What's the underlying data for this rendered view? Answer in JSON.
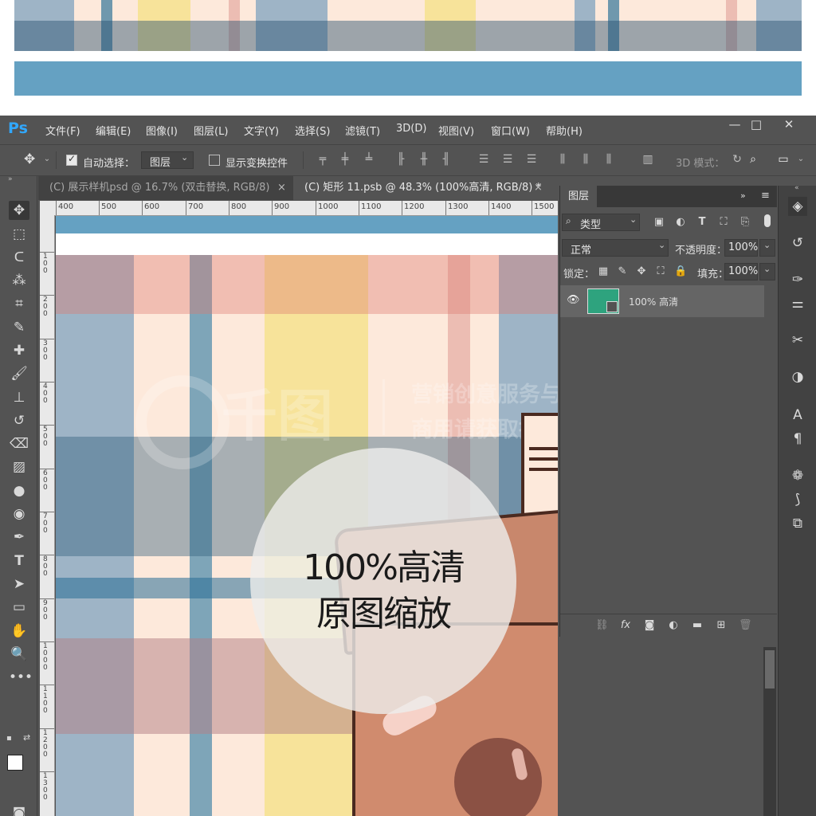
{
  "app": {
    "logo": "Ps",
    "menus": [
      "文件(F)",
      "编辑(E)",
      "图像(I)",
      "图层(L)",
      "文字(Y)",
      "选择(S)",
      "滤镜(T)",
      "3D(D)",
      "视图(V)",
      "窗口(W)",
      "帮助(H)"
    ],
    "window_controls": [
      "—",
      "□",
      "✕"
    ]
  },
  "options_bar": {
    "auto_select_label": "自动选择：",
    "auto_select_checked": true,
    "auto_select_target": "图层",
    "show_transform_label": "显示变换控件",
    "show_transform_checked": false,
    "mode_3d_label": "3D 模式："
  },
  "tabs": [
    {
      "label": "(C) 展示样机psd @ 16.7% (双击替换, RGB/8)",
      "active": false
    },
    {
      "label": "(C) 矩形 11.psb @ 48.3% (100%高清, RGB/8) *",
      "active": true
    }
  ],
  "tab_close": "×",
  "ruler": {
    "h_labels": [
      "400",
      "500",
      "600",
      "700",
      "800",
      "900",
      "1000",
      "1100",
      "1200",
      "1300",
      "1400",
      "1500"
    ],
    "v_labels": [
      "100",
      "200",
      "300",
      "400",
      "500",
      "600",
      "700",
      "800",
      "900",
      "1000",
      "1100",
      "1200",
      "1300"
    ]
  },
  "layers_panel": {
    "title": "图层",
    "filter_kind": "类型",
    "blend_mode": "正常",
    "opacity_label": "不透明度：",
    "opacity_value": "100%",
    "lock_label": "锁定：",
    "fill_label": "填充：",
    "fill_value": "100%",
    "layers": [
      {
        "name": "100% 高清",
        "visible": true,
        "thumb_color": "#2ea37e"
      }
    ]
  },
  "overlay": {
    "line1": "100%高清",
    "line2": "原图缩放"
  },
  "watermark": {
    "brand": "千图",
    "line1": "营销创意服务与协作平台",
    "line2": "商用请获取授权"
  },
  "colors": {
    "ps_bg": "#535353",
    "panel_bg": "#424242",
    "stripe_blue": "#65a1c2",
    "stripe_cream": "#fde9db",
    "stripe_yellow": "#f7e39a",
    "stripe_pink": "#ecbdb3",
    "stripe_slate": "#9eb4c6",
    "drink_brown": "#c88a6e"
  }
}
